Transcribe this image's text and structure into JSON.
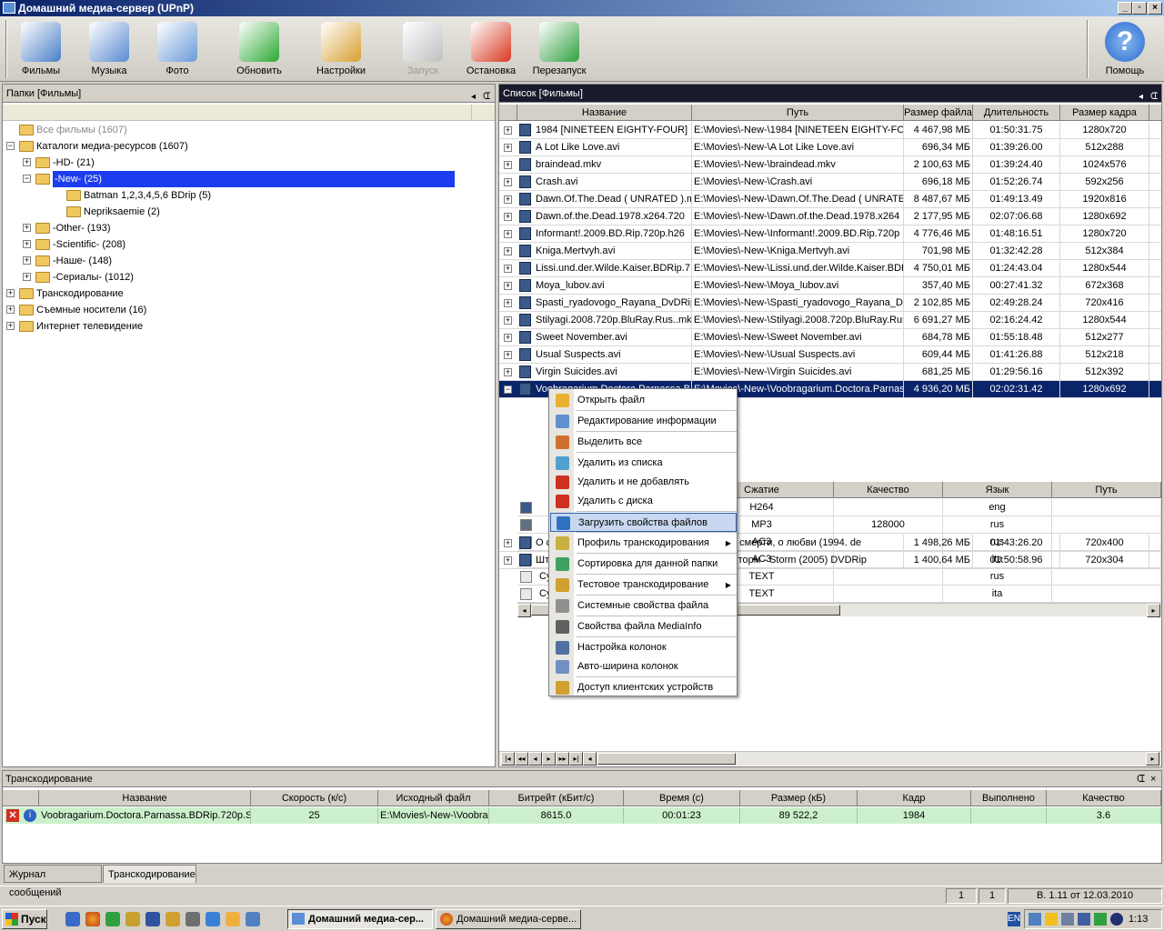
{
  "window": {
    "title": "Домашний медиа-сервер (UPnP)"
  },
  "toolbar": {
    "items": [
      {
        "label": "Фильмы",
        "icon": "films-icon",
        "color": "#4a7fc8"
      },
      {
        "label": "Музыка",
        "icon": "music-icon",
        "color": "#5a8ad0"
      },
      {
        "label": "Фото",
        "icon": "photo-icon",
        "color": "#6a9ad8"
      },
      {
        "label": "Обновить",
        "icon": "refresh-icon",
        "color": "#2aa830"
      },
      {
        "label": "Настройки",
        "icon": "settings-icon",
        "color": "#d8a030"
      },
      {
        "label": "Запуск",
        "icon": "start-icon",
        "color": "#c0c0c0",
        "disabled": true
      },
      {
        "label": "Остановка",
        "icon": "stop-icon",
        "color": "#d83820"
      },
      {
        "label": "Перезапуск",
        "icon": "restart-icon",
        "color": "#30a040"
      }
    ],
    "help": {
      "label": "Помощь",
      "icon": "help-icon",
      "color": "#3a7ad8"
    }
  },
  "left": {
    "title": "Папки [Фильмы]",
    "tree": [
      {
        "label": "Все фильмы (1607)",
        "grey": true
      },
      {
        "label": "Каталоги медиа-ресурсов (1607)"
      },
      {
        "label": "-HD- (21)"
      },
      {
        "label": "-New- (25)",
        "selected": true
      },
      {
        "label": "Batman 1,2,3,4,5,6 BDrip (5)"
      },
      {
        "label": "Nepriksaemie (2)"
      },
      {
        "label": "-Other- (193)"
      },
      {
        "label": "-Scientific- (208)"
      },
      {
        "label": "-Наше- (148)"
      },
      {
        "label": "-Сериалы- (1012)"
      },
      {
        "label": "Транскодирование"
      },
      {
        "label": "Съемные носители (16)"
      },
      {
        "label": "Интернет телевидение"
      }
    ]
  },
  "right": {
    "title": "Список [Фильмы]",
    "columns": [
      "Название",
      "Путь",
      "Размер файла",
      "Длительность",
      "Размер кадра"
    ],
    "rows": [
      [
        "1984 [NINETEEN EIGHTY-FOUR] 19",
        "E:\\Movies\\-New-\\1984 [NINETEEN EIGHTY-FOUI",
        "4 467,98 МБ",
        "01:50:31.75",
        "1280x720"
      ],
      [
        "A Lot Like Love.avi",
        "E:\\Movies\\-New-\\A Lot Like Love.avi",
        "696,34 МБ",
        "01:39:26.00",
        "512x288"
      ],
      [
        "braindead.mkv",
        "E:\\Movies\\-New-\\braindead.mkv",
        "2 100,63 МБ",
        "01:39:24.40",
        "1024x576"
      ],
      [
        "Crash.avi",
        "E:\\Movies\\-New-\\Crash.avi",
        "696,18 МБ",
        "01:52:26.74",
        "592x256"
      ],
      [
        "Dawn.Of.The.Dead ( UNRATED ).m",
        "E:\\Movies\\-New-\\Dawn.Of.The.Dead ( UNRATEI",
        "8 487,67 МБ",
        "01:49:13.49",
        "1920x816"
      ],
      [
        "Dawn.of.the.Dead.1978.x264.720",
        "E:\\Movies\\-New-\\Dawn.of.the.Dead.1978.x264",
        "2 177,95 МБ",
        "02:07:06.68",
        "1280x692"
      ],
      [
        "Informant!.2009.BD.Rip.720p.h26",
        "E:\\Movies\\-New-\\Informant!.2009.BD.Rip.720p",
        "4 776,46 МБ",
        "01:48:16.51",
        "1280x720"
      ],
      [
        "Kniga.Mertvyh.avi",
        "E:\\Movies\\-New-\\Kniga.Mertvyh.avi",
        "701,98 МБ",
        "01:32:42.28",
        "512x384"
      ],
      [
        "Lissi.und.der.Wilde.Kaiser.BDRip.7",
        "E:\\Movies\\-New-\\Lissi.und.der.Wilde.Kaiser.BDF",
        "4 750,01 МБ",
        "01:24:43.04",
        "1280x544"
      ],
      [
        "Moya_lubov.avi",
        "E:\\Movies\\-New-\\Moya_lubov.avi",
        "357,40 МБ",
        "00:27:41.32",
        "672x368"
      ],
      [
        "Spasti_ryadovogo_Rayana_DvDRip",
        "E:\\Movies\\-New-\\Spasti_ryadovogo_Rayana_Dv",
        "2 102,85 МБ",
        "02:49:28.24",
        "720x416"
      ],
      [
        "Stilyagi.2008.720p.BluRay.Rus..mk",
        "E:\\Movies\\-New-\\Stilyagi.2008.720p.BluRay.Rus",
        "6 691,27 МБ",
        "02:16:24.42",
        "1280x544"
      ],
      [
        "Sweet November.avi",
        "E:\\Movies\\-New-\\Sweet November.avi",
        "684,78 МБ",
        "01:55:18.48",
        "512x277"
      ],
      [
        "Usual Suspects.avi",
        "E:\\Movies\\-New-\\Usual Suspects.avi",
        "609,44 МБ",
        "01:41:26.88",
        "512x218"
      ],
      [
        "Virgin Suicides.avi",
        "E:\\Movies\\-New-\\Virgin Suicides.avi",
        "681,25 МБ",
        "01:29:56.16",
        "512x392"
      ],
      [
        "Voobragarium.Doctora.Parnassa.BI",
        "E:\\Movies\\-New-\\Voobragarium.Doctora.Parnas",
        "4 936,20 МБ",
        "02:02:31.42",
        "1280x692"
      ]
    ],
    "subtable": {
      "columns": [
        "Сжатие",
        "Качество",
        "Язык",
        "Путь"
      ],
      "rows": [
        [
          "H264",
          "",
          "eng",
          ""
        ],
        [
          "MP3",
          "128000",
          "rus",
          ""
        ],
        [
          "AC3",
          "",
          "rus",
          ""
        ],
        [
          "AC3",
          "",
          "ita",
          ""
        ],
        [
          "TEXT",
          "",
          "rus",
          ""
        ],
        [
          "TEXT",
          "",
          "ita",
          ""
        ]
      ],
      "leftcol": [
        "",
        "",
        "",
        "",
        "Су",
        "Су"
      ]
    },
    "after": [
      [
        "О с",
        "a-New-\\О смерти, о любви (1994. de",
        "1 498,26 МБ",
        "01:43:26.20",
        "720x400"
      ],
      [
        "Шт",
        "a-New-\\Шторм - Storm (2005) DVDRip",
        "1 400,64 МБ",
        "01:50:58.96",
        "720x304"
      ]
    ]
  },
  "context_menu": {
    "items": [
      {
        "label": "Открыть файл",
        "color": "#e8b030"
      },
      {
        "label": "Редактирование информации",
        "color": "#6090d0"
      },
      {
        "label": "Выделить все",
        "color": "#d07030"
      },
      {
        "label": "Удалить из списка",
        "color": "#50a0d0"
      },
      {
        "label": "Удалить и не добавлять",
        "color": "#d03020"
      },
      {
        "label": "Удалить с диска",
        "color": "#d03020"
      },
      {
        "label": "Загрузить свойства файлов",
        "color": "#3070c0",
        "highlighted": true
      },
      {
        "label": "Профиль транскодирования",
        "color": "#c8b040",
        "submenu": true
      },
      {
        "label": "Сортировка для данной папки",
        "color": "#40a060"
      },
      {
        "label": "Тестовое транскодирование",
        "color": "#d0a030",
        "submenu": true
      },
      {
        "label": "Системные свойства файла",
        "color": "#909090"
      },
      {
        "label": "Свойства файла MediaInfo",
        "color": "#606060"
      },
      {
        "label": "Настройка колонок",
        "color": "#5070a0"
      },
      {
        "label": "Авто-ширина колонок",
        "color": "#7090c0"
      },
      {
        "label": "Доступ клиентских устройств",
        "color": "#d0a030"
      }
    ]
  },
  "bottom": {
    "title": "Транскодирование",
    "columns": [
      "Название",
      "Скорость (к/с)",
      "Исходный файл",
      "Битрейт (кБит/с)",
      "Время (с)",
      "Размер (кБ)",
      "Кадр",
      "Выполнено",
      "Качество"
    ],
    "row": [
      "Voobragarium.Doctora.Parnassa.BDRip.720p.S(",
      "25",
      "E:\\Movies\\-New-\\Voobra",
      "8615.0",
      "00:01:23",
      "89 522,2",
      "1984",
      "",
      "3.6"
    ],
    "tabs": [
      "Журнал сообщений",
      "Транскодирование"
    ]
  },
  "status": {
    "a": "1",
    "b": "1",
    "version": "В. 1.11 от 12.03.2010"
  },
  "taskbar": {
    "start": "Пуск",
    "tasks": [
      "Домашний медиа-сер...",
      "Домашний медиа-серве..."
    ],
    "lang": "EN",
    "clock": "1:13"
  }
}
